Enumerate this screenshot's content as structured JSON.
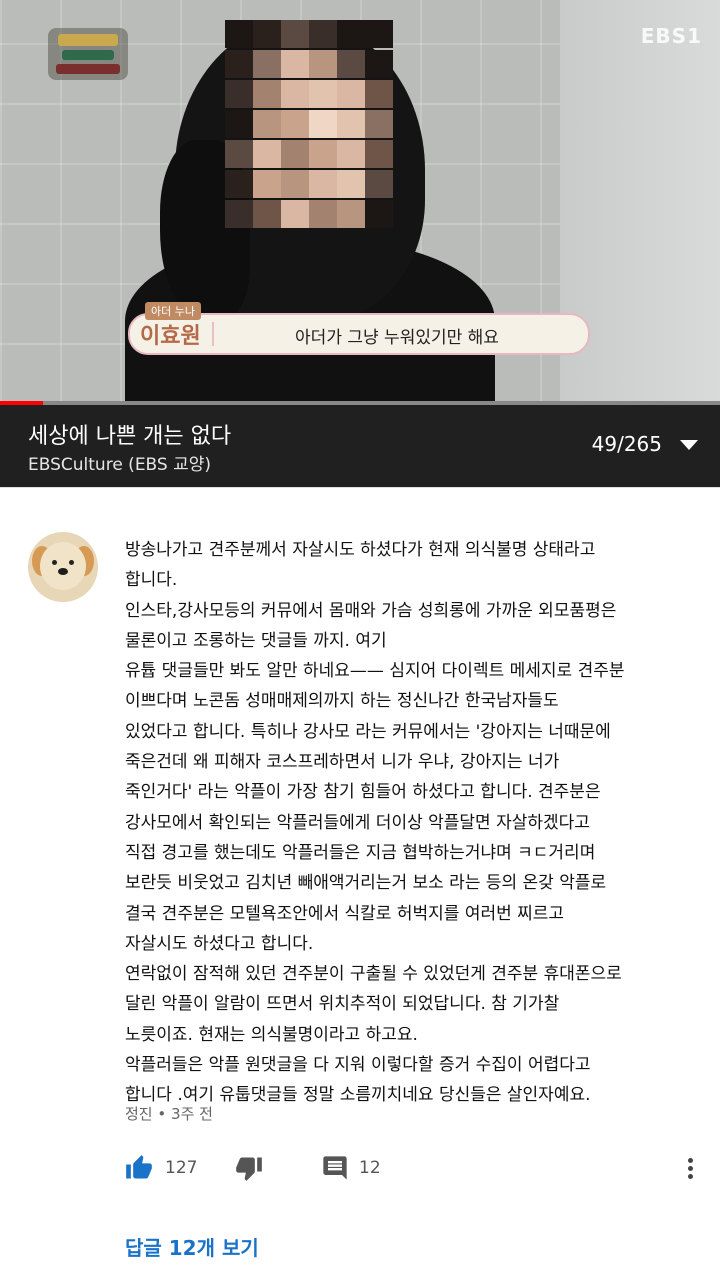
{
  "video": {
    "channel_logo": "EBS1",
    "caption_name_tag": "아더 누나",
    "caption_name": "이효원",
    "caption_text": "아더가 그냥 누워있기만 해요",
    "progress": 0.06,
    "accent_color": "#ff0000"
  },
  "playlist": {
    "title": "세상에 나쁜 개는 없다",
    "channel": "EBSCulture (EBS 교양)",
    "position": "49/265",
    "toggle_icon": "chevron-down-icon"
  },
  "comment": {
    "avatar_icon": "dog-avatar",
    "body": "방송나가고 견주분께서 자살시도 하셨다가  현재 의식불명 상태라고\n합니다.\n인스타,강사모등의 커뮤에서 몸매와 가슴 성희롱에 가까운 외모품평은\n물론이고 조롱하는 댓글들 까지. 여기\n유튭 댓글들만 봐도 알만 하네요—— 심지어 다이렉트 메세지로 견주분\n이쁘다며 노콘돔 성매매제의까지 하는 정신나간 한국남자들도\n있었다고 합니다. 특히나 강사모 라는 커뮤에서는 '강아지는 너때문에\n죽은건데 왜 피해자 코스프레하면서 니가 우냐, 강아지는 너가\n죽인거다' 라는 악플이 가장 참기 힘들어 하셨다고 합니다.  견주분은\n강사모에서 확인되는 악플러들에게 더이상 악플달면 자살하겠다고\n직접 경고를 했는데도 악플러들은 지금 협박하는거냐며 ㅋㄷ거리며\n보란듯 비웃었고 김치년 빼애액거리는거 보소 라는 등의 온갖 악플로\n결국 견주분은 모텔욕조안에서 식칼로 허벅지를 여러번 찌르고\n자살시도 하셨다고 합니다.\n연락없이 잠적해 있던 견주분이 구출될 수 있었던게 견주분 휴대폰으로\n달린 악플이 알람이 뜨면서 위치추적이 되었답니다.  참 기가찰\n노릇이죠. 현재는 의식불명이라고 하고요.\n악플러들은 악플 원댓글을 다 지워 이렇다할 증거 수집이 어렵다고\n합니다 .여기 유툽댓글들 정말 소름끼치네요 당신들은 살인자예요.",
    "author": "정진",
    "time": "3주 전",
    "meta_separator": "•",
    "likes": "127",
    "replies_count": "12",
    "view_replies": "답글 12개 보기",
    "link_color": "#1a73c9",
    "like_icon": "thumbs-up-icon",
    "dislike_icon": "thumbs-down-icon",
    "reply_icon": "comment-icon",
    "more_icon": "more-vert-icon"
  }
}
